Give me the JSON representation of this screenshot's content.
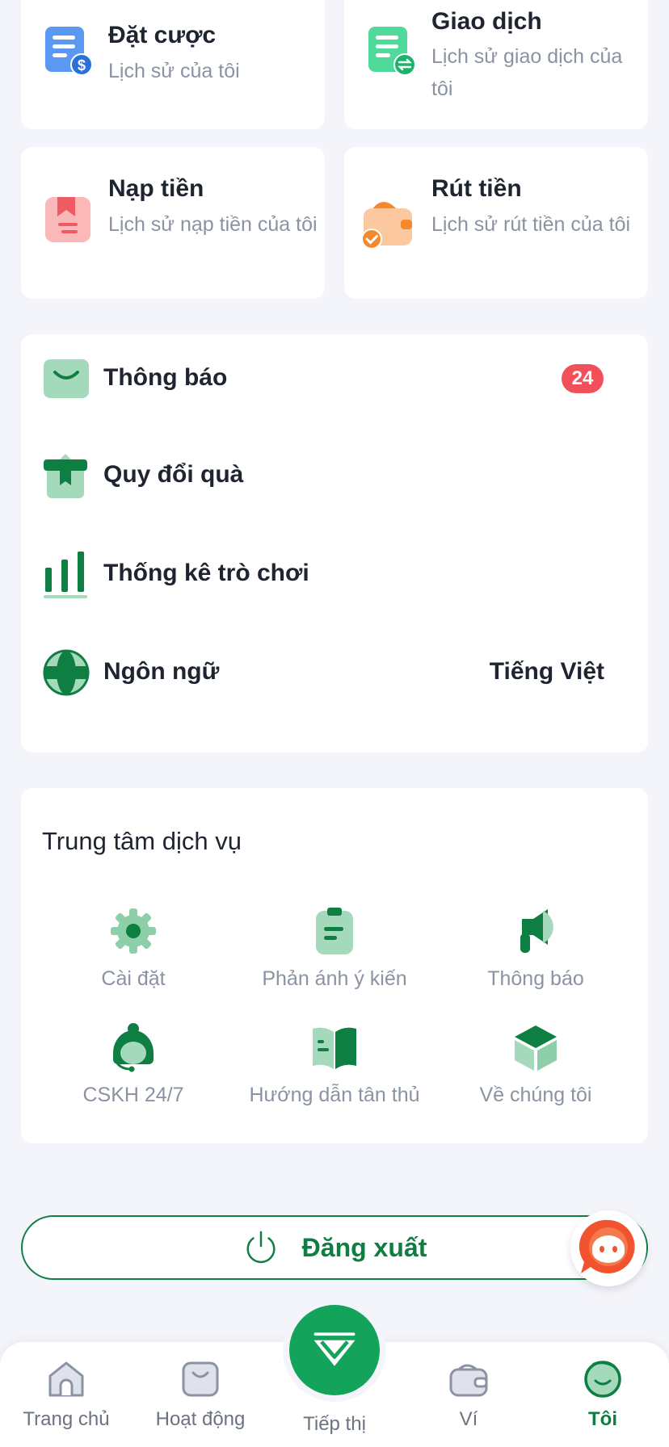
{
  "history_cards": [
    {
      "title": "Đặt cược",
      "subtitle": "Lịch sử của tôi",
      "icon": "bet-document-icon"
    },
    {
      "title": "Giao dịch",
      "subtitle": "Lịch sử giao dịch của tôi",
      "icon": "transaction-document-icon"
    },
    {
      "title": "Nạp tiền",
      "subtitle": "Lịch sử nạp tiền của tôi",
      "icon": "deposit-icon"
    },
    {
      "title": "Rút tiền",
      "subtitle": "Lịch sử rút tiền của tôi",
      "icon": "withdraw-wallet-icon"
    }
  ],
  "menu": {
    "notifications": {
      "label": "Thông báo",
      "badge": "24"
    },
    "gift": {
      "label": "Quy đổi quà"
    },
    "stats": {
      "label": "Thống kê trò chơi"
    },
    "language": {
      "label": "Ngôn ngữ",
      "value": "Tiếng Việt"
    }
  },
  "service_center": {
    "title": "Trung tâm dịch vụ",
    "items": [
      {
        "label": "Cài đặt",
        "icon": "gear-icon"
      },
      {
        "label": "Phản ánh ý kiến",
        "icon": "feedback-clipboard-icon"
      },
      {
        "label": "Thông báo",
        "icon": "megaphone-icon"
      },
      {
        "label": "CSKH 24/7",
        "icon": "support-agent-icon"
      },
      {
        "label": "Hướng dẫn tân thủ",
        "icon": "guide-book-icon"
      },
      {
        "label": "Về chúng tôi",
        "icon": "cube-icon"
      }
    ]
  },
  "logout": {
    "label": "Đăng xuất"
  },
  "bottom_nav": {
    "home": "Trang chủ",
    "activity": "Hoạt động",
    "marketing": "Tiếp thị",
    "wallet": "Ví",
    "me": "Tôi"
  },
  "colors": {
    "primary": "#0e7e42",
    "accent_green": "#13a35a",
    "badge_red": "#f1505a",
    "background": "#f4f5fa"
  }
}
